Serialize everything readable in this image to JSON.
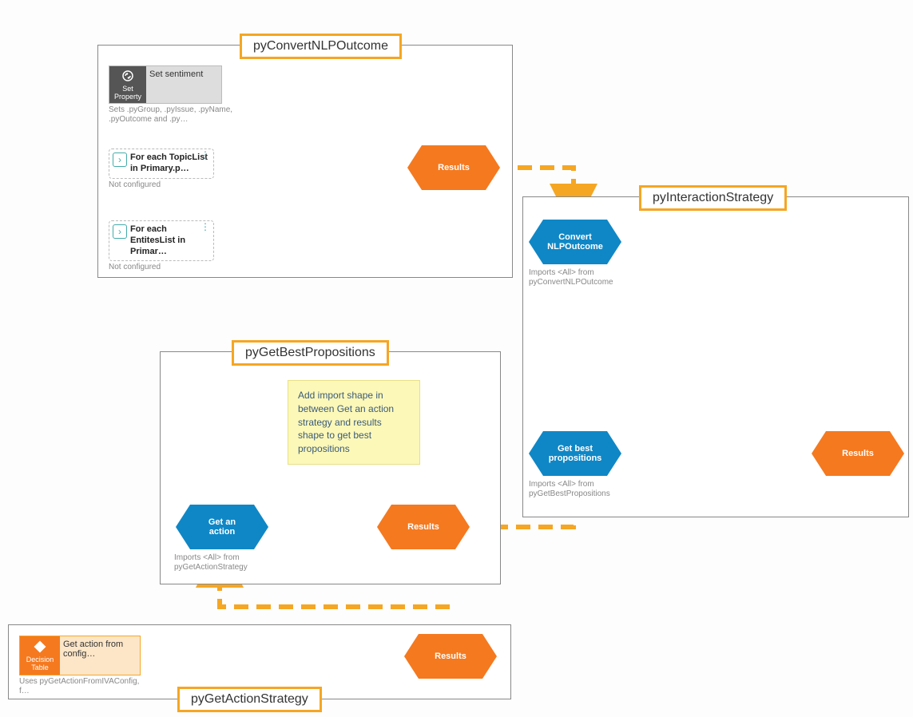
{
  "strategies": {
    "convert": {
      "title": "pyConvertNLPOutcome",
      "setProperty": {
        "iconLabel": "Set Property",
        "label": "Set sentiment",
        "sub": "Sets .pyGroup, .pyIssue, .pyName, .pyOutcome and .py…"
      },
      "topicList": {
        "label": "For each TopicList in Primary.p…",
        "sub": "Not configured"
      },
      "entityList": {
        "label": "For each EntitesList in Primar…",
        "sub": "Not configured"
      },
      "results": "Results"
    },
    "interaction": {
      "title": "pyInteractionStrategy",
      "convertShape": {
        "label": "Convert NLPOutcome",
        "sub": "Imports <All> from pyConvertNLPOutcome"
      },
      "getBestShape": {
        "label": "Get best propositions",
        "sub": "Imports <All> from pyGetBestPropositions"
      },
      "results": "Results"
    },
    "getBest": {
      "title": "pyGetBestPropositions",
      "note": "Add import shape in between Get an action strategy and results shape to get best propositions",
      "getAction": {
        "label": "Get an action",
        "sub": "Imports <All> from pyGetActionStrategy"
      },
      "results": "Results"
    },
    "getAction": {
      "title": "pyGetActionStrategy",
      "decision": {
        "iconLabel": "Decision Table",
        "label": "Get action from config…",
        "sub": "Uses pyGetActionFromIVAConfig, f…"
      },
      "results": "Results"
    }
  }
}
